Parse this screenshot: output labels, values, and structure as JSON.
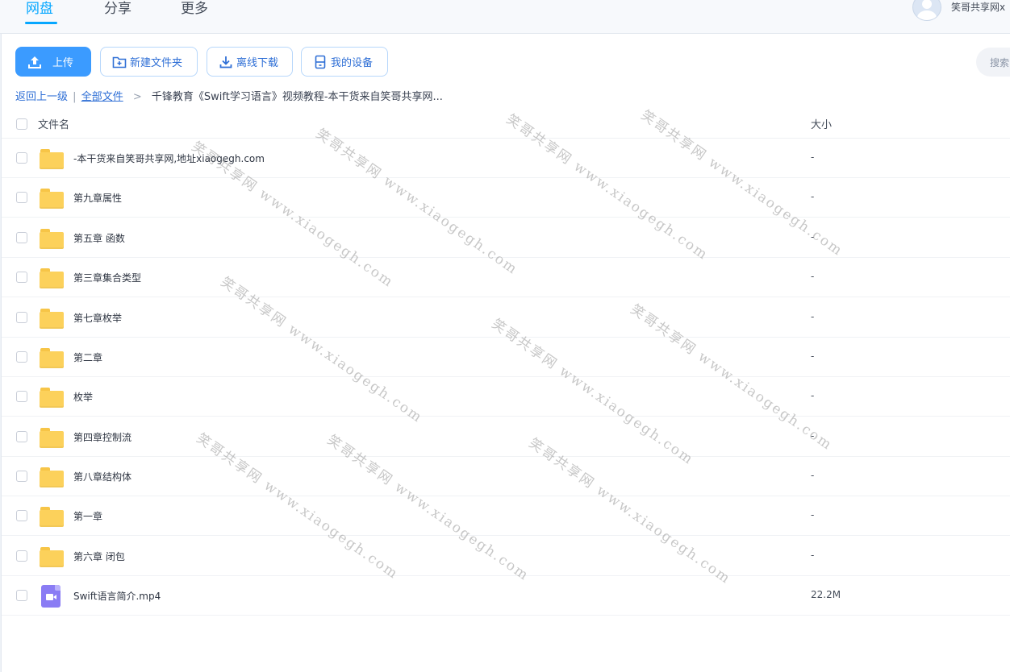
{
  "nav": {
    "tabs": [
      {
        "label": "网盘",
        "active": true
      },
      {
        "label": "分享",
        "active": false
      },
      {
        "label": "更多",
        "active": false
      }
    ],
    "username": "笑哥共享网x"
  },
  "toolbar": {
    "upload": "上传",
    "new_folder": "新建文件夹",
    "offline_download": "离线下载",
    "my_devices": "我的设备",
    "search_placeholder": "搜索"
  },
  "breadcrumb": {
    "back": "返回上一级",
    "divider": "|",
    "all_files": "全部文件",
    "sep": ">",
    "current": "千锋教育《Swift学习语言》视频教程-本干货来自笑哥共享网..."
  },
  "table": {
    "col_name": "文件名",
    "col_size": "大小",
    "rows": [
      {
        "name": "-本干货来自笑哥共享网,地址xiaogegh.com",
        "size": "-",
        "type": "folder"
      },
      {
        "name": "第九章属性",
        "size": "-",
        "type": "folder"
      },
      {
        "name": "第五章 函数",
        "size": "-",
        "type": "folder"
      },
      {
        "name": "第三章集合类型",
        "size": "-",
        "type": "folder"
      },
      {
        "name": "第七章枚举",
        "size": "-",
        "type": "folder"
      },
      {
        "name": "第二章",
        "size": "-",
        "type": "folder"
      },
      {
        "name": "枚举",
        "size": "-",
        "type": "folder"
      },
      {
        "name": "第四章控制流",
        "size": "-",
        "type": "folder"
      },
      {
        "name": "第八章结构体",
        "size": "-",
        "type": "folder"
      },
      {
        "name": "第一章",
        "size": "-",
        "type": "folder"
      },
      {
        "name": "第六章 闭包",
        "size": "-",
        "type": "folder"
      },
      {
        "name": "Swift语言简介.mp4",
        "size": "22.2M",
        "type": "video"
      }
    ]
  },
  "watermark": {
    "text": "笑哥共享网 www.xiaogegh.com"
  },
  "colors": {
    "accent": "#06a7ff",
    "primary_button": "#3b9bff",
    "folder": "#fcd15b",
    "video": "#8a7cf4"
  }
}
